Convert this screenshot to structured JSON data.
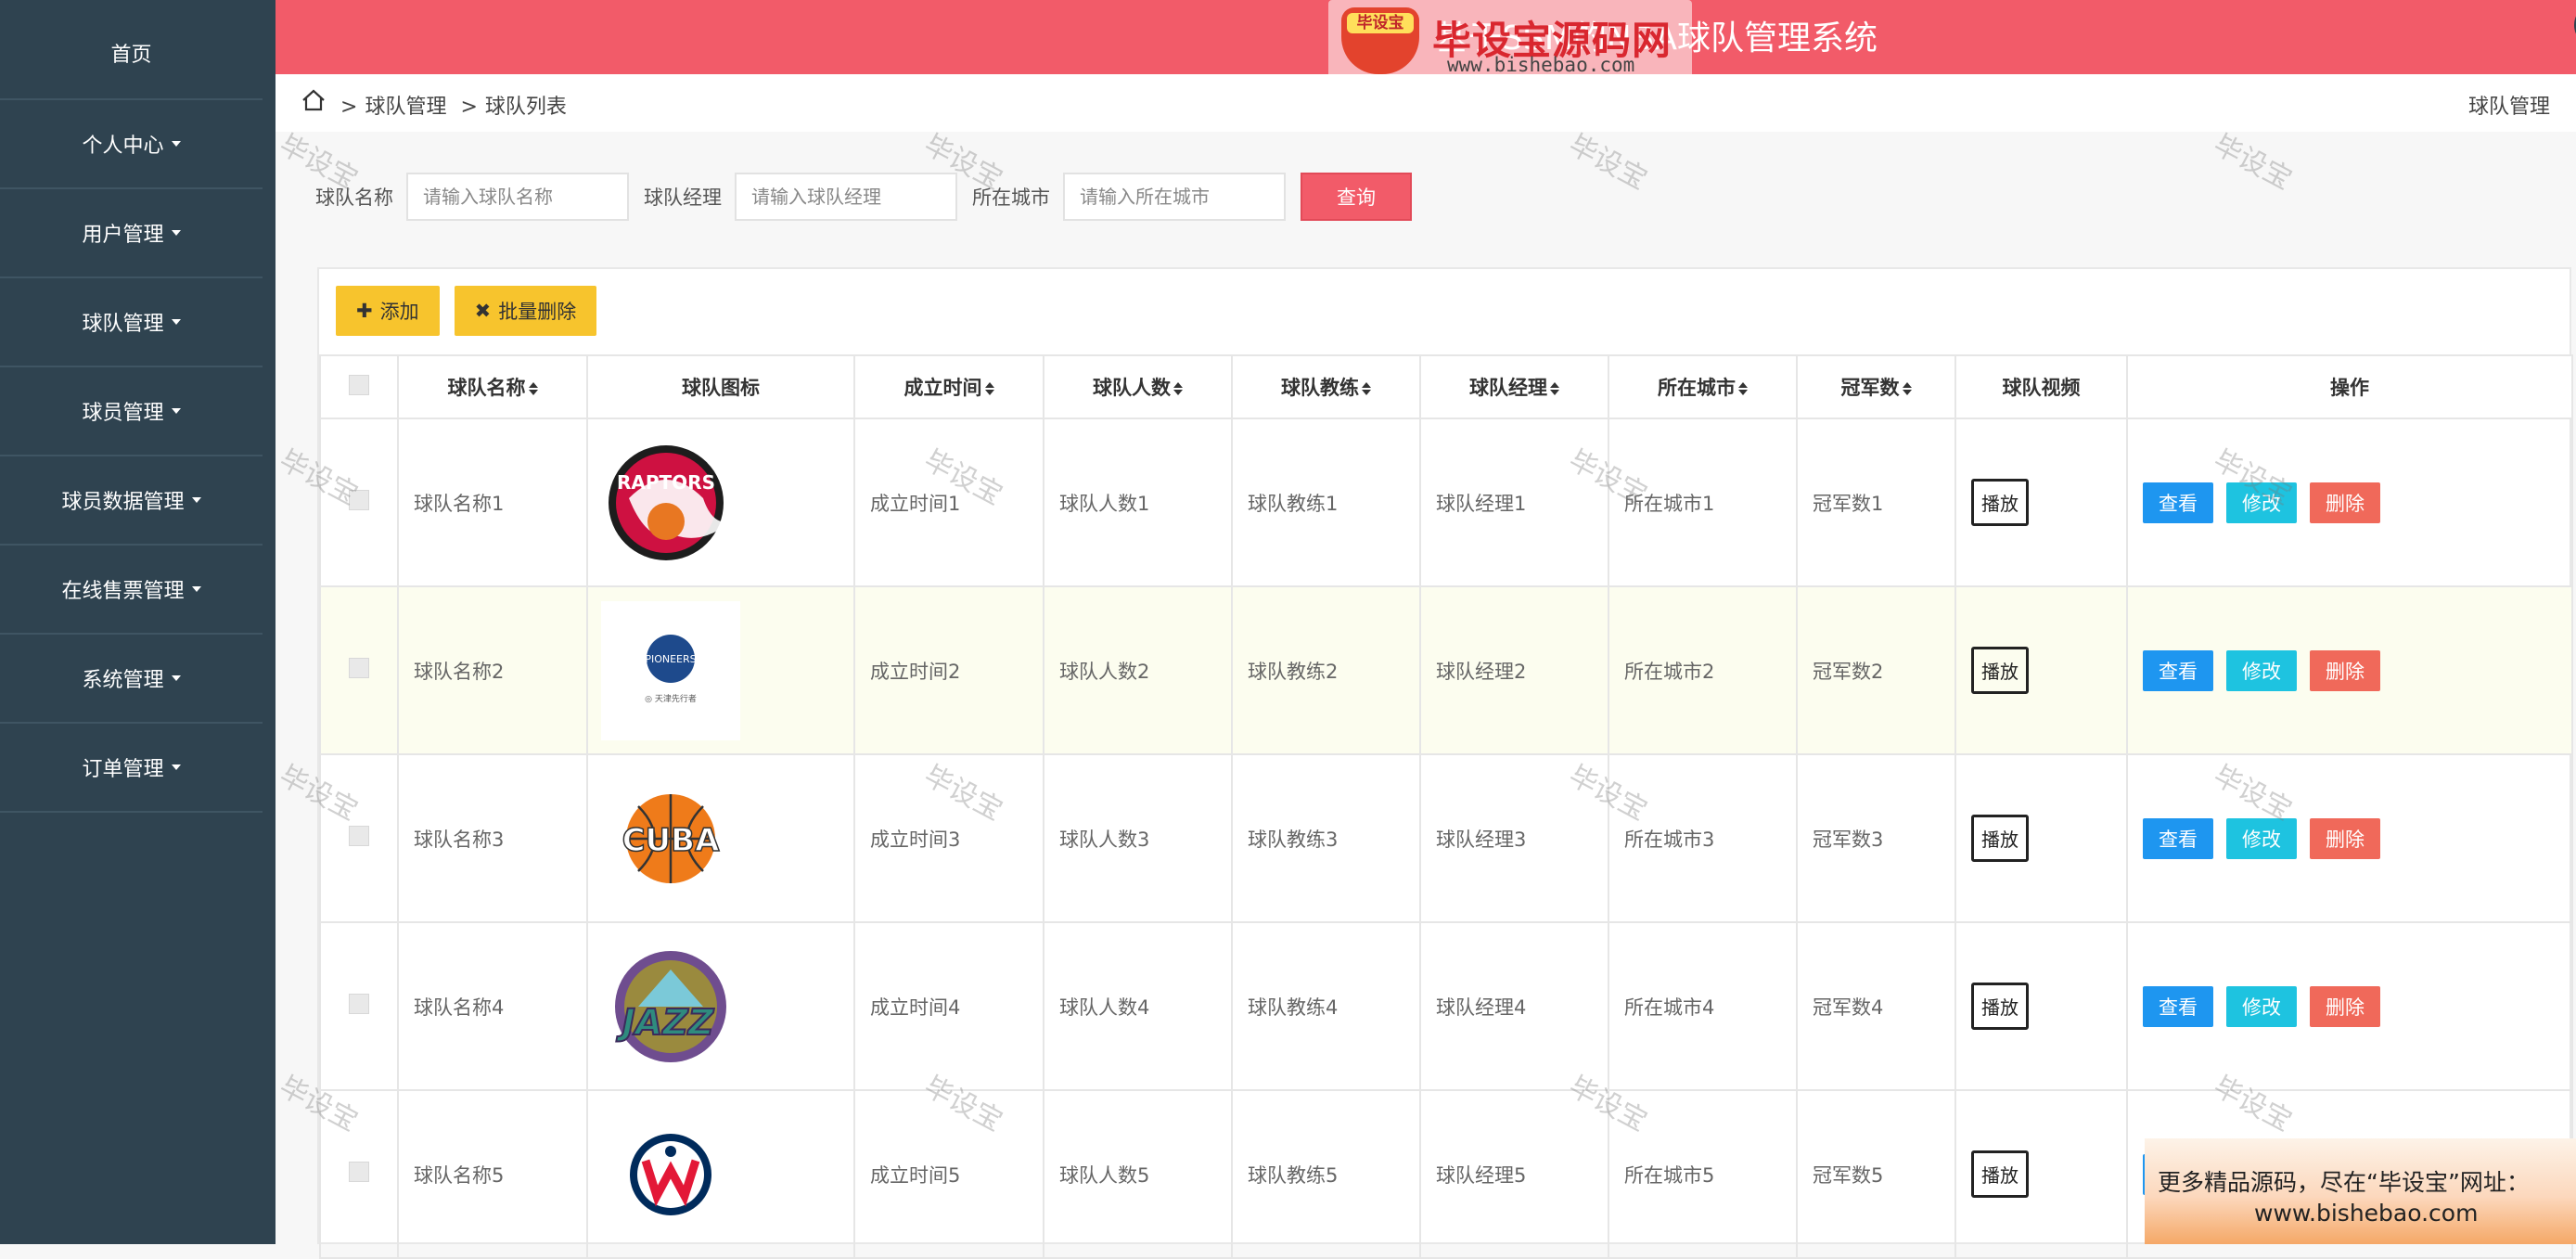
{
  "app": {
    "title": "基于SSM的NBA球队管理系统"
  },
  "logo": {
    "badge": "毕设宝",
    "main": "毕设宝源码网",
    "url": "www.bishebao.com"
  },
  "sidebar": {
    "items": [
      {
        "label": "首页",
        "caret": false
      },
      {
        "label": "个人中心",
        "caret": true
      },
      {
        "label": "用户管理",
        "caret": true
      },
      {
        "label": "球队管理",
        "caret": true
      },
      {
        "label": "球员管理",
        "caret": true
      },
      {
        "label": "球员数据管理",
        "caret": true
      },
      {
        "label": "在线售票管理",
        "caret": true
      },
      {
        "label": "系统管理",
        "caret": true
      },
      {
        "label": "订单管理",
        "caret": true
      }
    ]
  },
  "breadcrumb": {
    "items": [
      "球队管理",
      "球队列表"
    ],
    "right": "球队管理"
  },
  "search": {
    "name_label": "球队名称",
    "name_placeholder": "请输入球队名称",
    "manager_label": "球队经理",
    "manager_placeholder": "请输入球队经理",
    "city_label": "所在城市",
    "city_placeholder": "请输入所在城市",
    "query": "查询"
  },
  "toolbar": {
    "add": "添加",
    "batch_delete": "批量删除"
  },
  "table": {
    "headers": [
      "球队名称",
      "球队图标",
      "成立时间",
      "球队人数",
      "球队教练",
      "球队经理",
      "所在城市",
      "冠军数",
      "球队视频",
      "操作"
    ],
    "play": "播放",
    "ops": {
      "view": "查看",
      "edit": "修改",
      "delete": "删除"
    },
    "rows": [
      {
        "name": "球队名称1",
        "logo": "raptors",
        "founded": "成立时间1",
        "players": "球队人数1",
        "coach": "球队教练1",
        "manager": "球队经理1",
        "city": "所在城市1",
        "titles": "冠军数1"
      },
      {
        "name": "球队名称2",
        "logo": "pioneers",
        "founded": "成立时间2",
        "players": "球队人数2",
        "coach": "球队教练2",
        "manager": "球队经理2",
        "city": "所在城市2",
        "titles": "冠军数2"
      },
      {
        "name": "球队名称3",
        "logo": "cuba",
        "founded": "成立时间3",
        "players": "球队人数3",
        "coach": "球队教练3",
        "manager": "球队经理3",
        "city": "所在城市3",
        "titles": "冠军数3"
      },
      {
        "name": "球队名称4",
        "logo": "jazz",
        "founded": "成立时间4",
        "players": "球队人数4",
        "coach": "球队教练4",
        "manager": "球队经理4",
        "city": "所在城市4",
        "titles": "冠军数4"
      },
      {
        "name": "球队名称5",
        "logo": "wizards",
        "founded": "成立时间5",
        "players": "球队人数5",
        "coach": "球队教练5",
        "manager": "球队经理5",
        "city": "所在城市5",
        "titles": "冠军数5"
      }
    ]
  },
  "watermark": "毕设宝",
  "promo": {
    "line1": "更多精品源码，尽在“毕设宝”网址：",
    "line2": "www.bishebao.com"
  },
  "colors": {
    "sidebar": "#2f4350",
    "topbar": "#f25b69",
    "add": "#f7c42d",
    "view": "#1e96f0",
    "edit": "#1ec3e0",
    "delete": "#f0695a"
  }
}
